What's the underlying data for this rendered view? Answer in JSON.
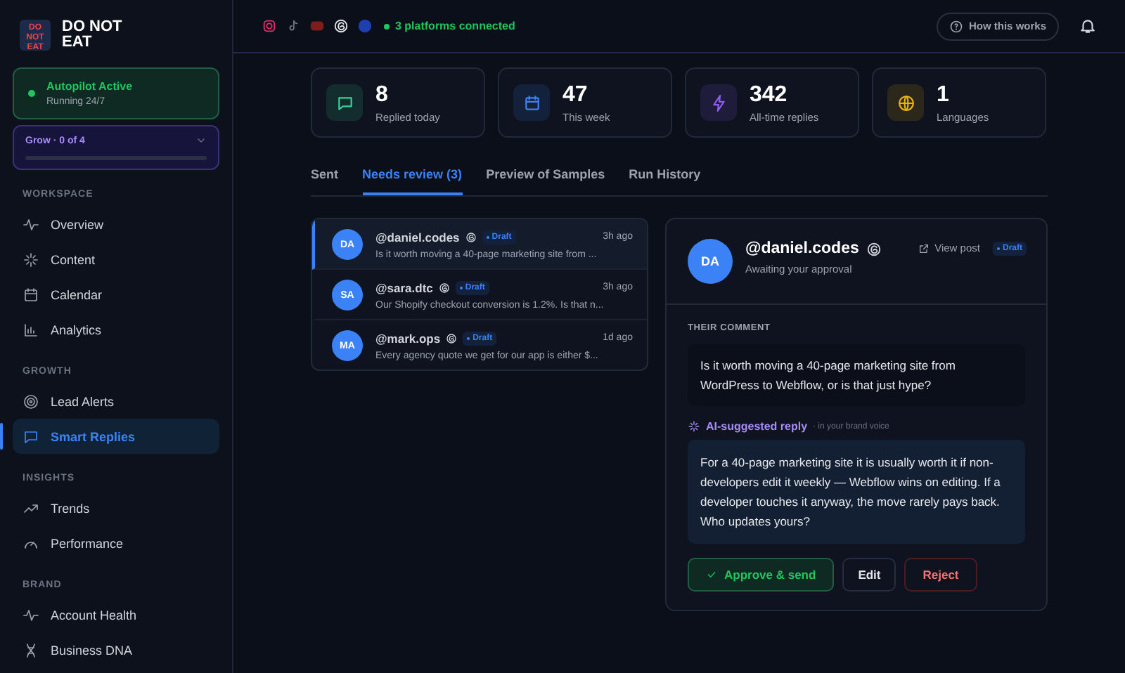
{
  "brand": {
    "logo": "DO NOT EAT",
    "name": "DO NOT EAT"
  },
  "autopilot": {
    "title": "Autopilot Active",
    "subtitle": "Running 24/7",
    "on": true
  },
  "grow": {
    "label": "Grow · 0 of 4",
    "level": 0
  },
  "sidebar": [
    {
      "heading": "WORKSPACE",
      "items": [
        {
          "label": "Overview",
          "selected": false
        },
        {
          "label": "Content",
          "selected": false
        },
        {
          "label": "Calendar",
          "selected": false
        },
        {
          "label": "Analytics",
          "selected": false
        }
      ]
    },
    {
      "heading": "GROWTH",
      "items": [
        {
          "label": "Lead Alerts",
          "selected": false
        },
        {
          "label": "Smart Replies",
          "selected": true
        }
      ]
    },
    {
      "heading": "INSIGHTS",
      "items": [
        {
          "label": "Trends",
          "selected": false
        },
        {
          "label": "Performance",
          "selected": false
        }
      ]
    },
    {
      "heading": "BRAND",
      "items": [
        {
          "label": "Account Health",
          "selected": false
        },
        {
          "label": "Business DNA",
          "selected": false
        }
      ]
    }
  ],
  "topbar": {
    "platforms": [
      {
        "kind": "instagram",
        "color": "#e1306c"
      },
      {
        "kind": "tiktok",
        "color": "#6b7280"
      },
      {
        "kind": "youtube",
        "color": "#7f1d1d"
      },
      {
        "kind": "threads",
        "color": "#e5e7eb"
      },
      {
        "kind": "facebook",
        "color": "#1e40af"
      }
    ],
    "status": "3 platforms connected",
    "help": "How this works"
  },
  "stats": [
    {
      "value": "8",
      "label": "Replied today",
      "color": "#34d399"
    },
    {
      "value": "47",
      "label": "This week",
      "color": "#3b82f6"
    },
    {
      "value": "342",
      "label": "All-time replies",
      "color": "#8b5cf6"
    },
    {
      "value": "1",
      "label": "Languages",
      "color": "#eab308"
    }
  ],
  "tabs": [
    {
      "label": "Sent",
      "selected": false
    },
    {
      "label": "Needs review (3)",
      "selected": true
    },
    {
      "label": "Preview of Samples",
      "selected": false
    },
    {
      "label": "Run History",
      "selected": false
    }
  ],
  "comments": [
    {
      "initials": "DA",
      "handle": "@daniel.codes",
      "badge": "Draft",
      "time": "3h ago",
      "preview": "Is it worth moving a 40-page marketing site from ...",
      "selected": true
    },
    {
      "initials": "SA",
      "handle": "@sara.dtc",
      "badge": "Draft",
      "time": "3h ago",
      "preview": "Our Shopify checkout conversion is 1.2%. Is that n...",
      "selected": false
    },
    {
      "initials": "MA",
      "handle": "@mark.ops",
      "badge": "Draft",
      "time": "1d ago",
      "preview": "Every agency quote we get for our app is either $...",
      "selected": false
    }
  ],
  "detail": {
    "initials": "DA",
    "handle": "@daniel.codes",
    "status": "Awaiting your approval",
    "view_post": "View post",
    "badge": "Draft",
    "comment_heading": "THEIR COMMENT",
    "comment": "Is it worth moving a 40-page marketing site from WordPress to Webflow, or is that just hype?",
    "reply_heading": "AI-suggested reply",
    "reply_note": "· in your brand voice",
    "reply": "For a 40-page marketing site it is usually worth it if non-developers edit it weekly — Webflow wins on editing. If a developer touches it anyway, the move rarely pays back. Who updates yours?",
    "buttons": [
      {
        "kind": "approve",
        "label": "Approve & send"
      },
      {
        "kind": "edit",
        "label": "Edit"
      },
      {
        "kind": "reject",
        "label": "Reject"
      }
    ]
  }
}
